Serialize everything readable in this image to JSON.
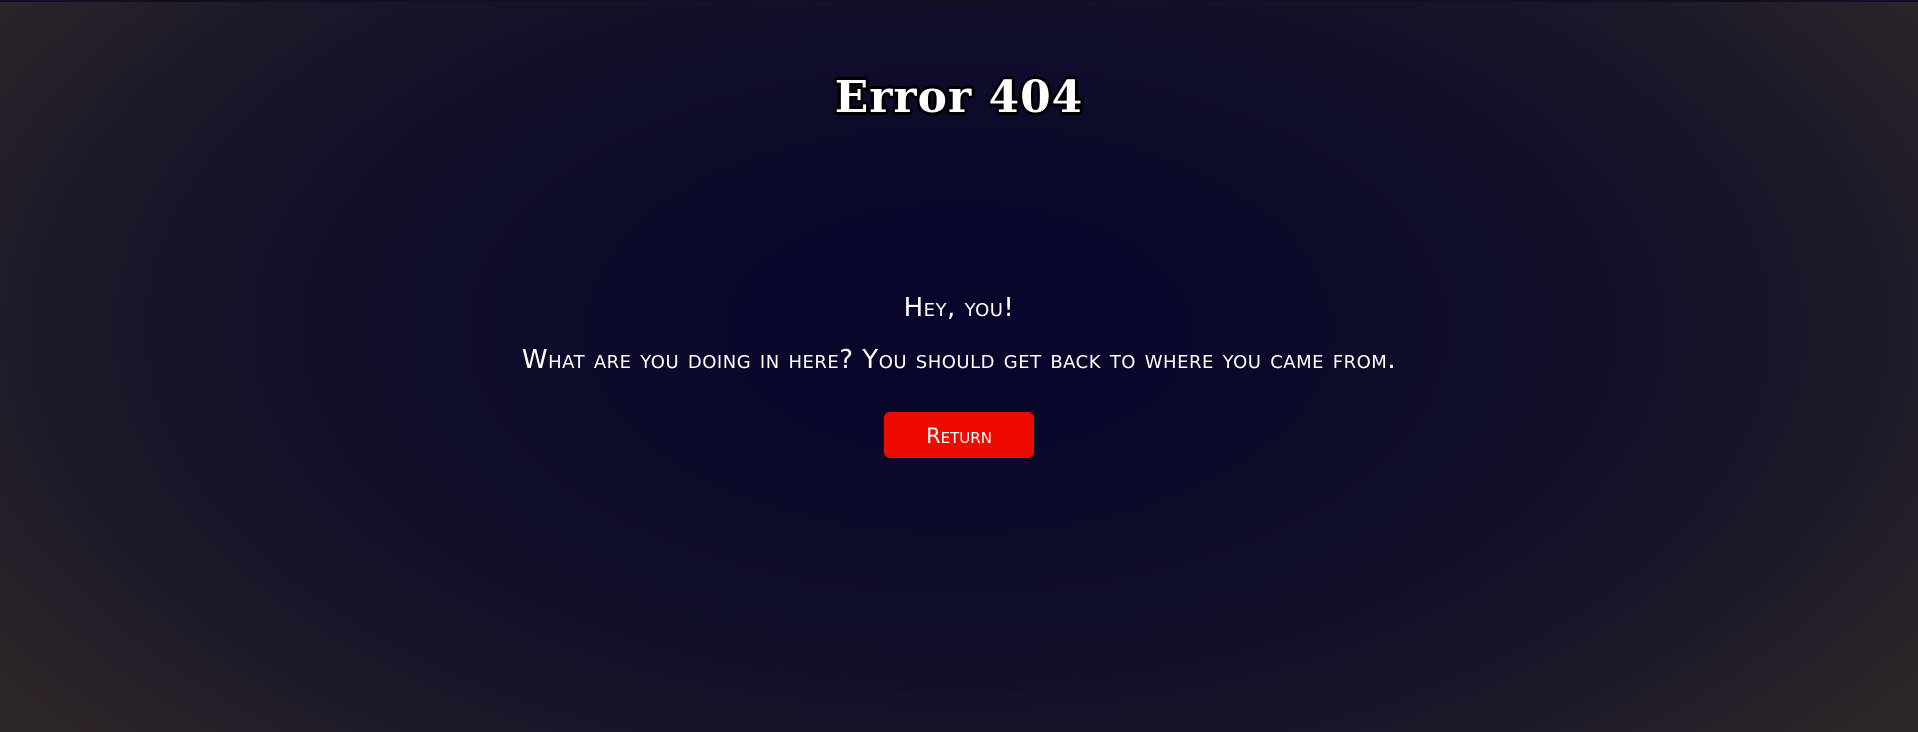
{
  "title": "Error 404",
  "message": {
    "line1": "Hey, you!",
    "line2": "What are you doing in here? You should get back to where you came from."
  },
  "return_button": {
    "label": "Return",
    "color": "#ef0a00"
  },
  "colors": {
    "background_center": "#06052a",
    "background_edge": "#2c2529",
    "text": "#ffffff"
  }
}
